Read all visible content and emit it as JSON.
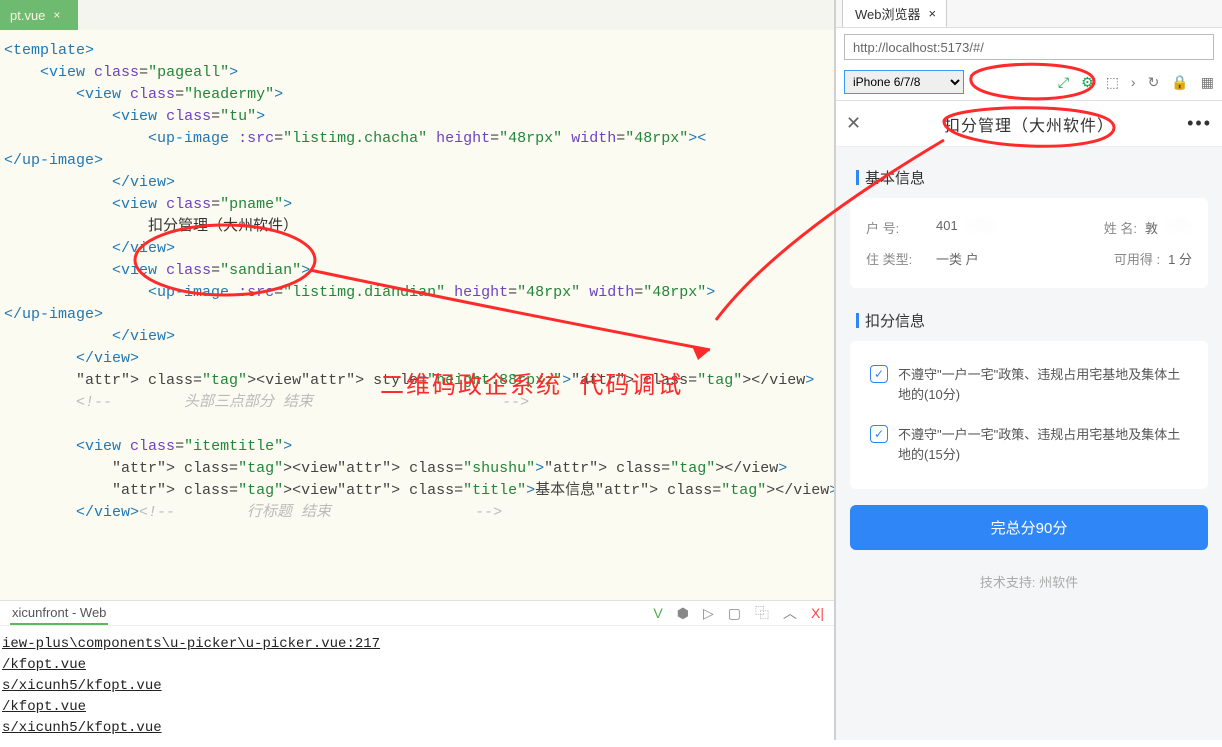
{
  "editor": {
    "tab_name": "pt.vue",
    "code_lines": [
      {
        "t": "tag",
        "indent": 0,
        "raw": "<template>"
      },
      {
        "t": "open",
        "indent": 1,
        "tag": "view",
        "attrs": [
          [
            "class",
            "pageall"
          ]
        ]
      },
      {
        "t": "open",
        "indent": 2,
        "tag": "view",
        "attrs": [
          [
            "class",
            "headermy"
          ]
        ]
      },
      {
        "t": "open",
        "indent": 3,
        "tag": "view",
        "attrs": [
          [
            "class",
            "tu"
          ]
        ]
      },
      {
        "t": "open",
        "indent": 4,
        "tag": "up-image",
        "attrs": [
          [
            ":src",
            "listimg.chacha"
          ],
          [
            "height",
            "48rpx"
          ],
          [
            "width",
            "48rpx"
          ]
        ],
        "selfend": "><"
      },
      {
        "t": "close",
        "indent": 0,
        "tag": "up-image"
      },
      {
        "t": "close",
        "indent": 3,
        "tag": "view"
      },
      {
        "t": "open",
        "indent": 3,
        "tag": "view",
        "attrs": [
          [
            "class",
            "pname"
          ]
        ]
      },
      {
        "t": "text",
        "indent": 4,
        "text": "扣分管理（大州软件）"
      },
      {
        "t": "close",
        "indent": 3,
        "tag": "view"
      },
      {
        "t": "open",
        "indent": 3,
        "tag": "view",
        "attrs": [
          [
            "class",
            "sandian"
          ]
        ]
      },
      {
        "t": "open",
        "indent": 4,
        "tag": "up-image",
        "attrs": [
          [
            ":src",
            "listimg.diandian"
          ],
          [
            "height",
            "48rpx"
          ],
          [
            "width",
            "48rpx"
          ]
        ]
      },
      {
        "t": "close",
        "indent": 0,
        "tag": "up-image"
      },
      {
        "t": "close",
        "indent": 3,
        "tag": "view"
      },
      {
        "t": "close",
        "indent": 2,
        "tag": "view"
      },
      {
        "t": "inline",
        "indent": 2,
        "raw": "<view style=\"height:88rpx;\"></view>"
      },
      {
        "t": "comment",
        "indent": 2,
        "text": "<!--        头部三点部分 结束                     -->"
      },
      {
        "t": "blank"
      },
      {
        "t": "open",
        "indent": 2,
        "tag": "view",
        "attrs": [
          [
            "class",
            "itemtitle"
          ]
        ]
      },
      {
        "t": "inline",
        "indent": 3,
        "raw": "<view class=\"shushu\"></view>"
      },
      {
        "t": "inline",
        "indent": 3,
        "raw": "<view class=\"title\">基本信息</view>"
      },
      {
        "t": "closecomment",
        "indent": 2,
        "tag": "view",
        "comment": "<!--        行标题 结束                -->"
      }
    ]
  },
  "console": {
    "tab_label": "xicunfront - Web",
    "lines": [
      "iew-plus\\components\\u-picker\\u-picker.vue:217",
      "/kfopt.vue",
      "s/xicunh5/kfopt.vue",
      "/kfopt.vue",
      "s/xicunh5/kfopt.vue"
    ]
  },
  "browser_panel": {
    "tab_title": "Web浏览器",
    "url": "http://localhost:5173/#/",
    "device": "iPhone 6/7/8",
    "phone": {
      "title": "扣分管理（大州软件）",
      "section1_title": "基本信息",
      "kv": {
        "k1": "户      号:",
        "v1": "401",
        "k2": "姓    名:",
        "v2": "敦",
        "k3": "住   类型:",
        "v3": "一类   户",
        "k4": "可用得   :",
        "v4": "1    分"
      },
      "section2_title": "扣分信息",
      "checks": [
        "不遵守\"一户一宅\"政策、违规占用宅基地及集体土地的(10分)",
        "不遵守\"一户一宅\"政策、违规占用宅基地及集体土地的(15分)"
      ],
      "button": "完总分90分",
      "footer": "技术支持:   州软件"
    }
  },
  "annotation": {
    "text1": "二维码政企系统",
    "text2": "代码调试"
  }
}
